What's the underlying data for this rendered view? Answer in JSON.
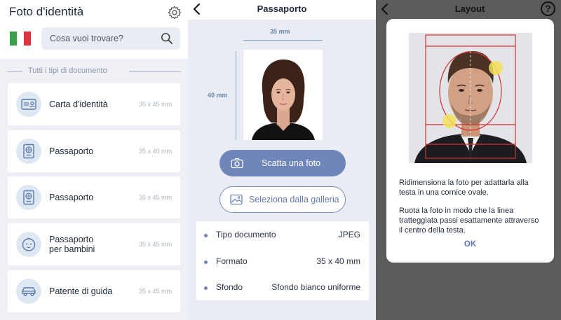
{
  "panel1": {
    "title": "Foto d'identità",
    "search": {
      "placeholder": "Cosa vuoi trovare?"
    },
    "flag_colors": [
      "#3a9e4a",
      "#ffffff",
      "#d8353f"
    ],
    "section_header": "Tutti i tipi di documento",
    "documents": [
      {
        "label": "Carta d'identità",
        "size": "35 x 45 mm",
        "icon": "id-card-icon"
      },
      {
        "label": "Passaporto",
        "size": "35 x 40 mm",
        "icon": "passport-icon"
      },
      {
        "label": "Passaporto",
        "size": "35 x 45 mm",
        "icon": "passport-icon"
      },
      {
        "label_line1": "Passaporto",
        "label_line2": "per bambini",
        "size": "35 x 45 mm",
        "icon": "baby-face-icon"
      },
      {
        "label": "Patente di guida",
        "size": "35 x 45 mm",
        "icon": "car-icon"
      }
    ]
  },
  "panel2": {
    "title": "Passaporto",
    "width_label": "35 mm",
    "height_label": "40 mm",
    "take_photo": "Scatta una foto",
    "gallery": "Seleziona dalla galleria",
    "info": [
      {
        "key": "Tipo documento",
        "value": "JPEG"
      },
      {
        "key": "Formato",
        "value": "35 x 40 mm"
      },
      {
        "key": "Sfondo",
        "value": "Sfondo bianco uniforme"
      }
    ]
  },
  "panel3": {
    "title": "Layout",
    "help": "?",
    "text1": "Ridimensiona la foto per adattarla alla testa in una cornice ovale.",
    "text2": "Ruota la foto in modo che la linea tratteggiata passi esattamente attraverso il centro della testa.",
    "ok": "OK"
  },
  "colors": {
    "accent": "#6f86ba",
    "accent_text": "#5f78ab",
    "guide_red": "#d92f2f",
    "handle_yellow": "#f2e05a"
  }
}
